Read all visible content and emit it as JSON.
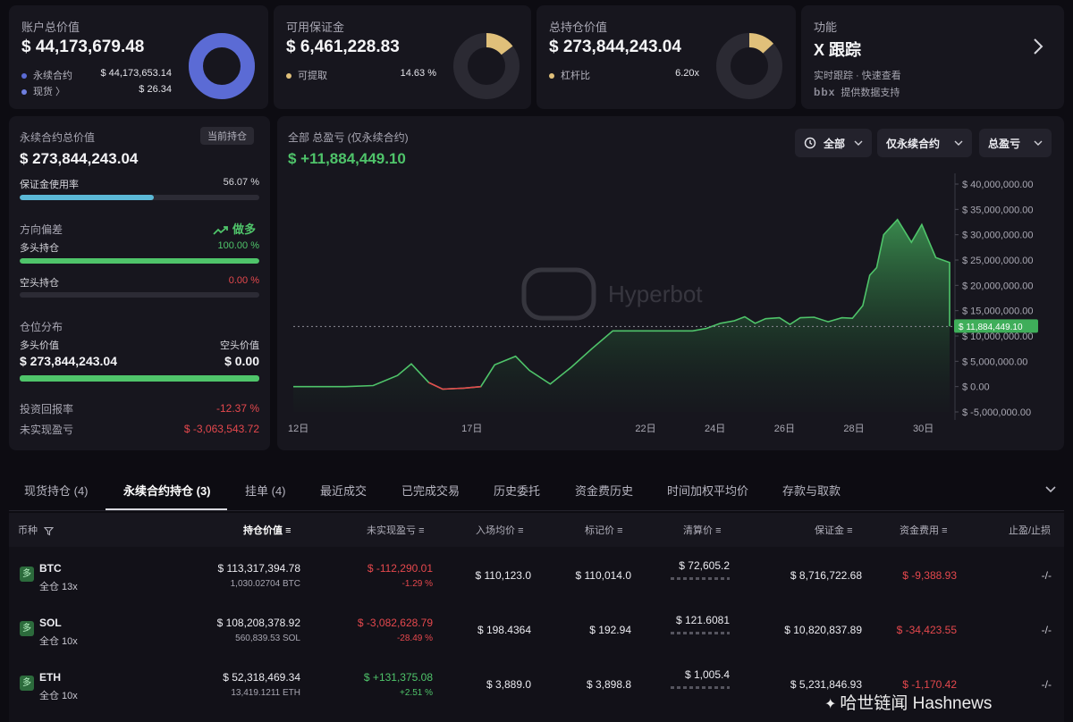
{
  "summary": {
    "account": {
      "title": "账户总价值",
      "value": "$ 44,173,679.48",
      "rows": [
        {
          "label": "永续合约",
          "value": "$ 44,173,653.14",
          "color": "#5b6bd5"
        },
        {
          "label": "现货 〉",
          "value": "$ 26.34",
          "color": "#6f7fe0"
        }
      ],
      "donut": {
        "fraction": 0.9999,
        "color": "#5b6bd5"
      }
    },
    "margin": {
      "title": "可用保证金",
      "value": "$ 6,461,228.83",
      "row_label": "可提取",
      "row_value": "14.63 %",
      "donut": {
        "fraction": 0.1463,
        "color": "#e0c07a"
      }
    },
    "position": {
      "title": "总持仓价值",
      "value": "$ 273,844,243.04",
      "row_label": "杠杆比",
      "row_value": "6.20x",
      "donut": {
        "fraction": 0.13,
        "color": "#e0c07a"
      }
    },
    "feature": {
      "title": "功能",
      "value": "X 跟踪",
      "desc": "实时跟踪 · 快速查看",
      "logo": "bbx",
      "powered": "提供数据支持"
    }
  },
  "left_panel": {
    "perp_title": "永续合约总价值",
    "perp_badge": "当前持仓",
    "perp_value": "$ 273,844,243.04",
    "margin_usage_label": "保证金使用率",
    "margin_usage_value": "56.07 %",
    "margin_usage_fraction": 0.5607,
    "direction_label": "方向偏差",
    "direction_value": "做多",
    "long_label": "多头持仓",
    "long_value": "100.00 %",
    "long_fraction": 1.0,
    "short_label": "空头持仓",
    "short_value": "0.00 %",
    "short_fraction": 0.0,
    "distribution_label": "仓位分布",
    "long_value_label": "多头价值",
    "short_value_label": "空头价值",
    "long_amount": "$ 273,844,243.04",
    "short_amount": "$ 0.00",
    "roi_label": "投资回报率",
    "roi_value": "-12.37 %",
    "unrealized_label": "未实现盈亏",
    "unrealized_value": "$ -3,063,543.72"
  },
  "chart_panel": {
    "title": "全部 总盈亏 (仅永续合约)",
    "value": "$ +11,884,449.10",
    "filter_all": "全部",
    "filter_perp": "仅永续合约",
    "filter_pnl": "总盈亏",
    "watermark": "Hyperbot",
    "current_label": "$ 11,884,449.10"
  },
  "chart_data": {
    "type": "area",
    "title": "全部 总盈亏 (仅永续合约)",
    "xlabel": "",
    "ylabel": "",
    "ylim": [
      -5000000,
      40000000
    ],
    "yticks": [
      40000000,
      35000000,
      30000000,
      25000000,
      20000000,
      15000000,
      10000000,
      5000000,
      0,
      -5000000
    ],
    "ytick_labels": [
      "$ 40,000,000.00",
      "$ 35,000,000.00",
      "$ 30,000,000.00",
      "$ 25,000,000.00",
      "$ 20,000,000.00",
      "$ 15,000,000.00",
      "$ 10,000,000.00",
      "$ 5,000,000.00",
      "$ 0.00",
      "$ -5,000,000.00"
    ],
    "xticks": [
      12,
      17,
      22,
      24,
      26,
      28,
      30
    ],
    "xtick_labels": [
      "12日",
      "17日",
      "22日",
      "24日",
      "26日",
      "28日",
      "30日"
    ],
    "xlim": [
      12,
      30.9
    ],
    "current_value": 11884449.1,
    "line_color": "#4fc46a",
    "negative_color": "#e5484d",
    "points": [
      [
        12.0,
        0.0
      ],
      [
        13.5,
        0.0
      ],
      [
        14.3,
        200000
      ],
      [
        15.0,
        2200000
      ],
      [
        15.4,
        4500000
      ],
      [
        15.9,
        800000
      ],
      [
        16.3,
        -500000
      ],
      [
        16.9,
        -300000
      ],
      [
        17.4,
        0.0
      ],
      [
        17.8,
        4300000
      ],
      [
        18.4,
        6000000
      ],
      [
        18.8,
        3200000
      ],
      [
        19.4,
        500000
      ],
      [
        20.0,
        3800000
      ],
      [
        20.6,
        7500000
      ],
      [
        21.2,
        11000000
      ],
      [
        22.0,
        11000000
      ],
      [
        22.8,
        11000000
      ],
      [
        23.5,
        11000000
      ],
      [
        23.9,
        11500000
      ],
      [
        24.3,
        12500000
      ],
      [
        24.7,
        13000000
      ],
      [
        25.0,
        13800000
      ],
      [
        25.3,
        12500000
      ],
      [
        25.6,
        13400000
      ],
      [
        26.0,
        13600000
      ],
      [
        26.3,
        12300000
      ],
      [
        26.6,
        13600000
      ],
      [
        27.0,
        13700000
      ],
      [
        27.4,
        12800000
      ],
      [
        27.8,
        13600000
      ],
      [
        28.1,
        13500000
      ],
      [
        28.4,
        16000000
      ],
      [
        28.6,
        22000000
      ],
      [
        28.8,
        23500000
      ],
      [
        29.0,
        30000000
      ],
      [
        29.4,
        33000000
      ],
      [
        29.8,
        28500000
      ],
      [
        30.1,
        32000000
      ],
      [
        30.5,
        25500000
      ],
      [
        30.9,
        24500000
      ]
    ]
  },
  "tabs": [
    {
      "label": "现货持仓 (4)",
      "active": false
    },
    {
      "label": "永续合约持仓 (3)",
      "active": true
    },
    {
      "label": "挂单 (4)",
      "active": false
    },
    {
      "label": "最近成交",
      "active": false
    },
    {
      "label": "已完成交易",
      "active": false
    },
    {
      "label": "历史委托",
      "active": false
    },
    {
      "label": "资金费历史",
      "active": false
    },
    {
      "label": "时间加权平均价",
      "active": false
    },
    {
      "label": "存款与取款",
      "active": false
    }
  ],
  "table": {
    "headers": [
      "币种",
      "持仓价值",
      "未实现盈亏",
      "入场均价",
      "标记价",
      "清算价",
      "保证金",
      "资金费用",
      "止盈/止损"
    ],
    "rows": [
      {
        "side": "多",
        "coin": "BTC",
        "mode": "全仓 13x",
        "value": "$ 113,317,394.78",
        "size": "1,030.02704 BTC",
        "pnl": "$ -112,290.01",
        "pnl_pct": "-1.29 %",
        "entry": "$ 110,123.0",
        "mark": "$ 110,014.0",
        "liq": "$ 72,605.2",
        "margin": "$ 8,716,722.68",
        "funding": "$ -9,388.93",
        "tpsl": "-/-"
      },
      {
        "side": "多",
        "coin": "SOL",
        "mode": "全仓 10x",
        "value": "$ 108,208,378.92",
        "size": "560,839.53 SOL",
        "pnl": "$ -3,082,628.79",
        "pnl_pct": "-28.49 %",
        "entry": "$ 198.4364",
        "mark": "$ 192.94",
        "liq": "$ 121.6081",
        "margin": "$ 10,820,837.89",
        "funding": "$ -34,423.55",
        "tpsl": "-/-"
      },
      {
        "side": "多",
        "coin": "ETH",
        "mode": "全仓 10x",
        "value": "$ 52,318,469.34",
        "size": "13,419.1211 ETH",
        "pnl": "$ +131,375.08",
        "pnl_pct": "+2.51 %",
        "entry": "$ 3,889.0",
        "mark": "$ 3,898.8",
        "liq": "$ 1,005.4",
        "margin": "$ 5,231,846.93",
        "funding": "$ -1,170.42",
        "tpsl": "-/-"
      }
    ]
  },
  "watermark_footer": "哈世链闻 Hashnews"
}
